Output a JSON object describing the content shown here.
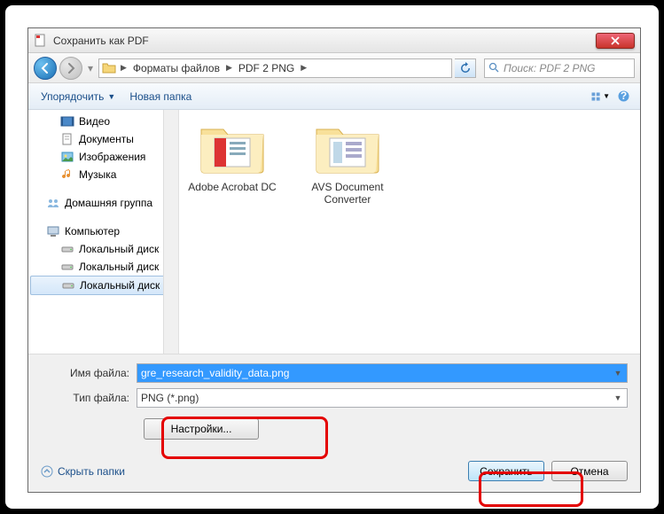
{
  "titlebar": {
    "title": "Сохранить как PDF"
  },
  "nav": {
    "crumb1": "Форматы файлов",
    "crumb2": "PDF 2 PNG",
    "search_placeholder": "Поиск: PDF 2 PNG"
  },
  "toolbar": {
    "organize": "Упорядочить",
    "newfolder": "Новая папка"
  },
  "tree": {
    "video": "Видео",
    "documents": "Документы",
    "pictures": "Изображения",
    "music": "Музыка",
    "homegroup": "Домашняя группа",
    "computer": "Компьютер",
    "disk1": "Локальный диск",
    "disk2": "Локальный диск",
    "disk3": "Локальный диск"
  },
  "folders": {
    "f1": "Adobe Acrobat DC",
    "f2": "AVS Document Converter"
  },
  "fields": {
    "filename_label": "Имя файла:",
    "filename_value": "gre_research_validity_data.png",
    "filetype_label": "Тип файла:",
    "filetype_value": "PNG (*.png)",
    "settings_btn": "Настройки...",
    "hide_folders": "Скрыть папки",
    "save": "Сохранить",
    "cancel": "Отмена"
  }
}
